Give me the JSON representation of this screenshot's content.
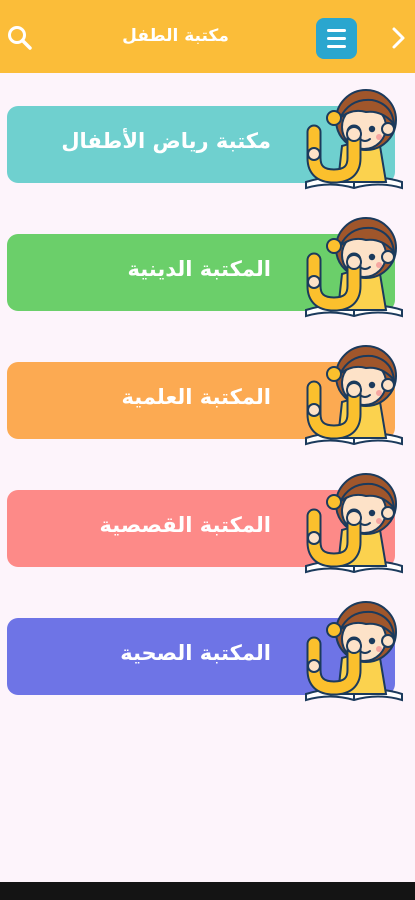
{
  "appbar": {
    "title": "مكتبة الطفل",
    "bg_color": "#fbbd39",
    "menu_color": "#2aa6cf",
    "left_icon": "search-icon",
    "menu_icon": "hamburger-icon",
    "right_icon": "chevron-right-icon"
  },
  "categories": [
    {
      "label": "مكتبة رياض الأطفال",
      "color": "#6fd0cf"
    },
    {
      "label": "المكتبة الدينية",
      "color": "#6bcf6a"
    },
    {
      "label": "المكتبة العلمية",
      "color": "#fcaa52"
    },
    {
      "label": "المكتبة القصصية",
      "color": "#fd8a88"
    },
    {
      "label": "المكتبة الصحية",
      "color": "#6e74e6"
    }
  ],
  "mascot_icon": "kid-reading-letter-noon"
}
